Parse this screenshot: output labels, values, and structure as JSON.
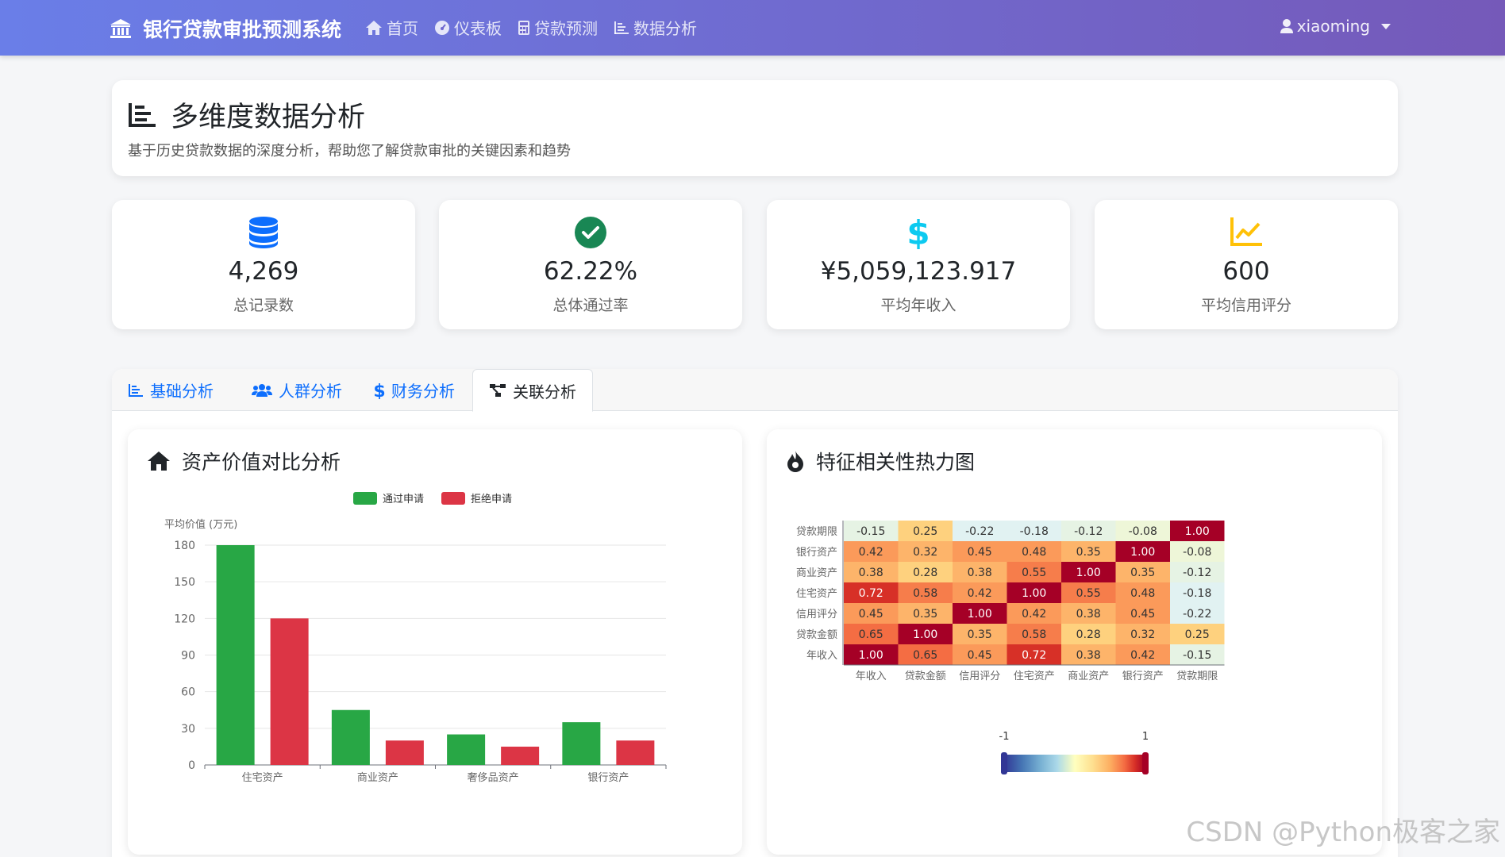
{
  "navbar": {
    "brand": "银行贷款审批预测系统",
    "links": [
      {
        "label": "首页",
        "icon": "home-icon"
      },
      {
        "label": "仪表板",
        "icon": "dashboard-icon"
      },
      {
        "label": "贷款预测",
        "icon": "calculator-icon"
      },
      {
        "label": "数据分析",
        "icon": "chart-icon"
      }
    ],
    "user": "xiaoming"
  },
  "header": {
    "title": "多维度数据分析",
    "subtitle": "基于历史贷款数据的深度分析，帮助您了解贷款审批的关键因素和趋势"
  },
  "stats": [
    {
      "value": "4,269",
      "label": "总记录数",
      "icon": "database-icon",
      "color": "#0d6efd"
    },
    {
      "value": "62.22%",
      "label": "总体通过率",
      "icon": "check-circle-icon",
      "color": "#198754"
    },
    {
      "value": "¥5,059,123.917",
      "label": "平均年收入",
      "icon": "dollar-icon",
      "color": "#0dcaf0"
    },
    {
      "value": "600",
      "label": "平均信用评分",
      "icon": "line-chart-icon",
      "color": "#ffc107"
    }
  ],
  "tabs": [
    {
      "label": "基础分析",
      "icon": "bar-chart-icon",
      "active": false
    },
    {
      "label": "人群分析",
      "icon": "users-icon",
      "active": false
    },
    {
      "label": "财务分析",
      "icon": "dollar-icon",
      "active": false
    },
    {
      "label": "关联分析",
      "icon": "sitemap-icon",
      "active": true
    }
  ],
  "asset_card": {
    "title": "资产价值对比分析",
    "icon": "home-icon"
  },
  "heatmap_card": {
    "title": "特征相关性热力图",
    "icon": "fire-icon"
  },
  "watermark": "CSDN @Python极客之家",
  "chart_data": [
    {
      "type": "bar",
      "title": "资产价值对比分析",
      "ylabel": "平均价值 (万元)",
      "xlabel": "",
      "ylim": [
        0,
        180
      ],
      "yticks": [
        0,
        30,
        60,
        90,
        120,
        150,
        180
      ],
      "categories": [
        "住宅资产",
        "商业资产",
        "奢侈品资产",
        "银行资产"
      ],
      "legend_position": "top-center",
      "series": [
        {
          "name": "通过申请",
          "color": "#28a745",
          "values": [
            180,
            45,
            25,
            35
          ]
        },
        {
          "name": "拒绝申请",
          "color": "#dc3545",
          "values": [
            120,
            20,
            15,
            20
          ]
        }
      ]
    },
    {
      "type": "heatmap",
      "title": "特征相关性热力图",
      "x_labels": [
        "年收入",
        "贷款金额",
        "信用评分",
        "住宅资产",
        "商业资产",
        "银行资产",
        "贷款期限"
      ],
      "y_labels": [
        "年收入",
        "贷款金额",
        "信用评分",
        "住宅资产",
        "商业资产",
        "银行资产",
        "贷款期限"
      ],
      "matrix": [
        [
          1.0,
          0.65,
          0.45,
          0.72,
          0.38,
          0.42,
          -0.15
        ],
        [
          0.65,
          1.0,
          0.35,
          0.58,
          0.28,
          0.32,
          0.25
        ],
        [
          0.45,
          0.35,
          1.0,
          0.42,
          0.38,
          0.45,
          -0.22
        ],
        [
          0.72,
          0.58,
          0.42,
          1.0,
          0.55,
          0.48,
          -0.18
        ],
        [
          0.38,
          0.28,
          0.38,
          0.55,
          1.0,
          0.35,
          -0.12
        ],
        [
          0.42,
          0.32,
          0.45,
          0.48,
          0.35,
          1.0,
          -0.08
        ],
        [
          -0.15,
          0.25,
          -0.22,
          -0.18,
          -0.12,
          -0.08,
          1.0
        ]
      ],
      "visual_map": {
        "min": -1,
        "max": 1,
        "min_label": "-1",
        "max_label": "1"
      }
    }
  ]
}
